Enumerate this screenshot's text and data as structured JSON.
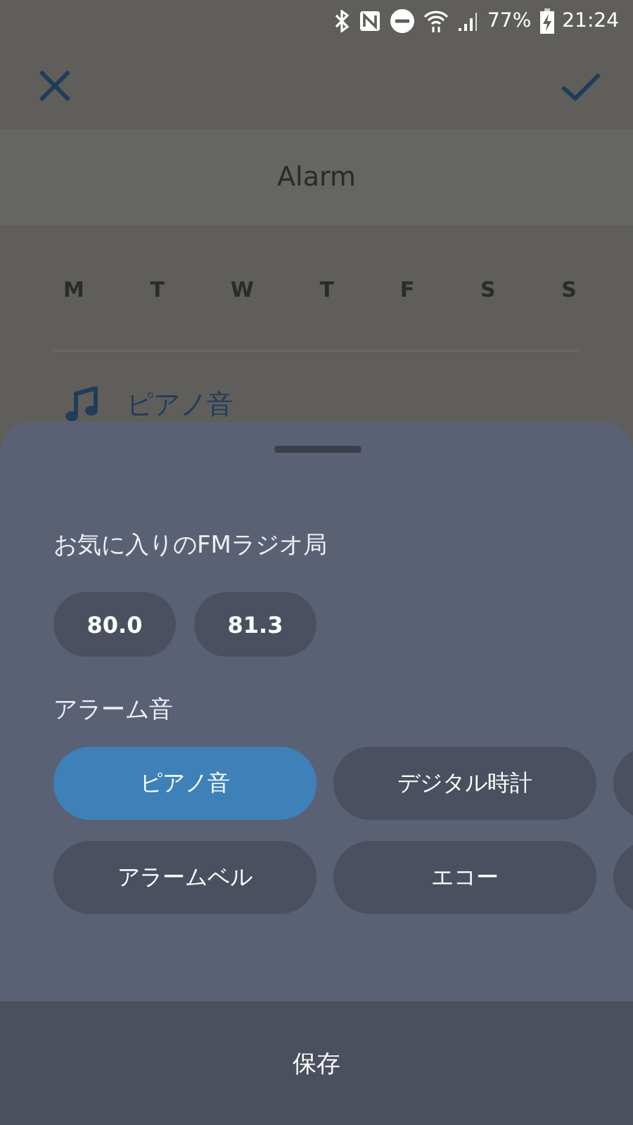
{
  "status_bar": {
    "battery": "77%",
    "time": "21:24"
  },
  "header": {
    "title": "Alarm"
  },
  "days": [
    {
      "label": "M"
    },
    {
      "label": "T"
    },
    {
      "label": "W"
    },
    {
      "label": "T"
    },
    {
      "label": "F"
    },
    {
      "label": "S"
    },
    {
      "label": "S"
    }
  ],
  "tone": {
    "label": "ピアノ音"
  },
  "sheet": {
    "radio_label": "お気に入りのFMラジオ局",
    "stations": [
      {
        "label": "80.0"
      },
      {
        "label": "81.3"
      }
    ],
    "sound_label": "アラーム音",
    "sounds": [
      {
        "label": "ピアノ音",
        "selected": true
      },
      {
        "label": "デジタル時計",
        "selected": false
      },
      {
        "label": "アラームベル",
        "selected": false
      },
      {
        "label": "エコー",
        "selected": false
      }
    ],
    "save": "保存"
  }
}
